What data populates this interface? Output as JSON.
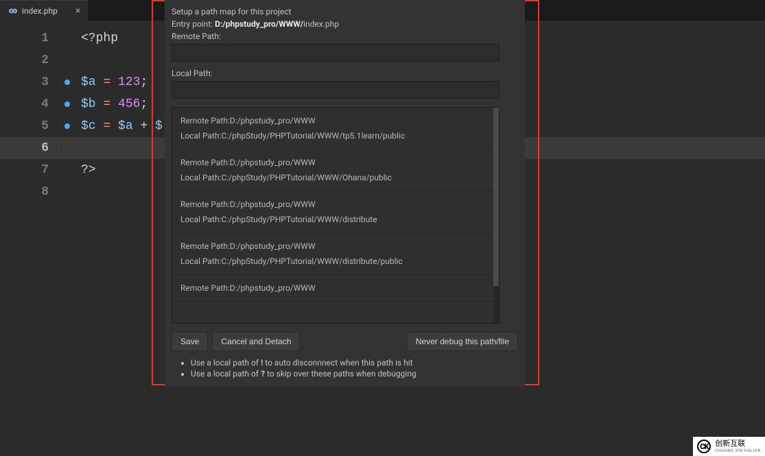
{
  "tab": {
    "title": "index.php",
    "icon_name": "elephant-icon",
    "close_glyph": "×"
  },
  "code": {
    "line_numbers": [
      "1",
      "2",
      "3",
      "4",
      "5",
      "6",
      "7",
      "8"
    ],
    "current_line_index": 5,
    "lines": [
      {
        "dot": false,
        "tokens": [
          [
            "tok-tag",
            "<?php"
          ]
        ]
      },
      {
        "dot": false,
        "tokens": []
      },
      {
        "dot": true,
        "tokens": [
          [
            "tok-var",
            "$a"
          ],
          [
            "tok-punc",
            " "
          ],
          [
            "tok-op",
            "="
          ],
          [
            "tok-punc",
            " "
          ],
          [
            "tok-num",
            "123"
          ],
          [
            "tok-punc",
            ";"
          ]
        ]
      },
      {
        "dot": true,
        "tokens": [
          [
            "tok-var",
            "$b"
          ],
          [
            "tok-punc",
            " "
          ],
          [
            "tok-op",
            "="
          ],
          [
            "tok-punc",
            " "
          ],
          [
            "tok-num",
            "456"
          ],
          [
            "tok-punc",
            ";"
          ]
        ]
      },
      {
        "dot": true,
        "tokens": [
          [
            "tok-var",
            "$c"
          ],
          [
            "tok-punc",
            " "
          ],
          [
            "tok-op",
            "="
          ],
          [
            "tok-punc",
            " "
          ],
          [
            "tok-var",
            "$a"
          ],
          [
            "tok-punc",
            " + "
          ],
          [
            "tok-var",
            "$"
          ]
        ]
      },
      {
        "dot": false,
        "tokens": []
      },
      {
        "dot": false,
        "tokens": [
          [
            "tok-tag",
            "?>"
          ]
        ]
      },
      {
        "dot": false,
        "tokens": []
      }
    ]
  },
  "dialog": {
    "heading": "Setup a path map for this project",
    "entry_point_label": "Entry point: ",
    "entry_point_bold": "D:/phpstudy_pro/WWW/",
    "entry_point_file": "index.php",
    "remote_label": "Remote Path:",
    "remote_value": "",
    "local_label": "Local Path:",
    "local_value": "",
    "mappings": [
      {
        "remote": "Remote Path:D:/phpstudy_pro/WWW",
        "local": "Local Path:C:/phpStudy/PHPTutorial/WWW/tp5.1learn/public"
      },
      {
        "remote": "Remote Path:D:/phpstudy_pro/WWW",
        "local": "Local Path:C:/phpStudy/PHPTutorial/WWW/Ohana/public"
      },
      {
        "remote": "Remote Path:D:/phpstudy_pro/WWW",
        "local": "Local Path:C:/phpStudy/PHPTutorial/WWW/distribute"
      },
      {
        "remote": "Remote Path:D:/phpstudy_pro/WWW",
        "local": "Local Path:C:/phpStudy/PHPTutorial/WWW/distribute/public"
      },
      {
        "remote": "Remote Path:D:/phpstudy_pro/WWW",
        "local": ""
      }
    ],
    "buttons": {
      "save": "Save",
      "cancel": "Cancel and Detach",
      "never": "Never debug this path/file"
    },
    "hints": [
      {
        "pre": "Use a local path of ",
        "bold": "!",
        "post": " to auto disconnnect when this path is hit"
      },
      {
        "pre": "Use a local path of ",
        "bold": "?",
        "post": " to skip over these paths when debugging"
      }
    ]
  },
  "watermark": {
    "glyph": "CK",
    "cn": "创新互联",
    "en": "CHUANG XIN HULIAN"
  }
}
